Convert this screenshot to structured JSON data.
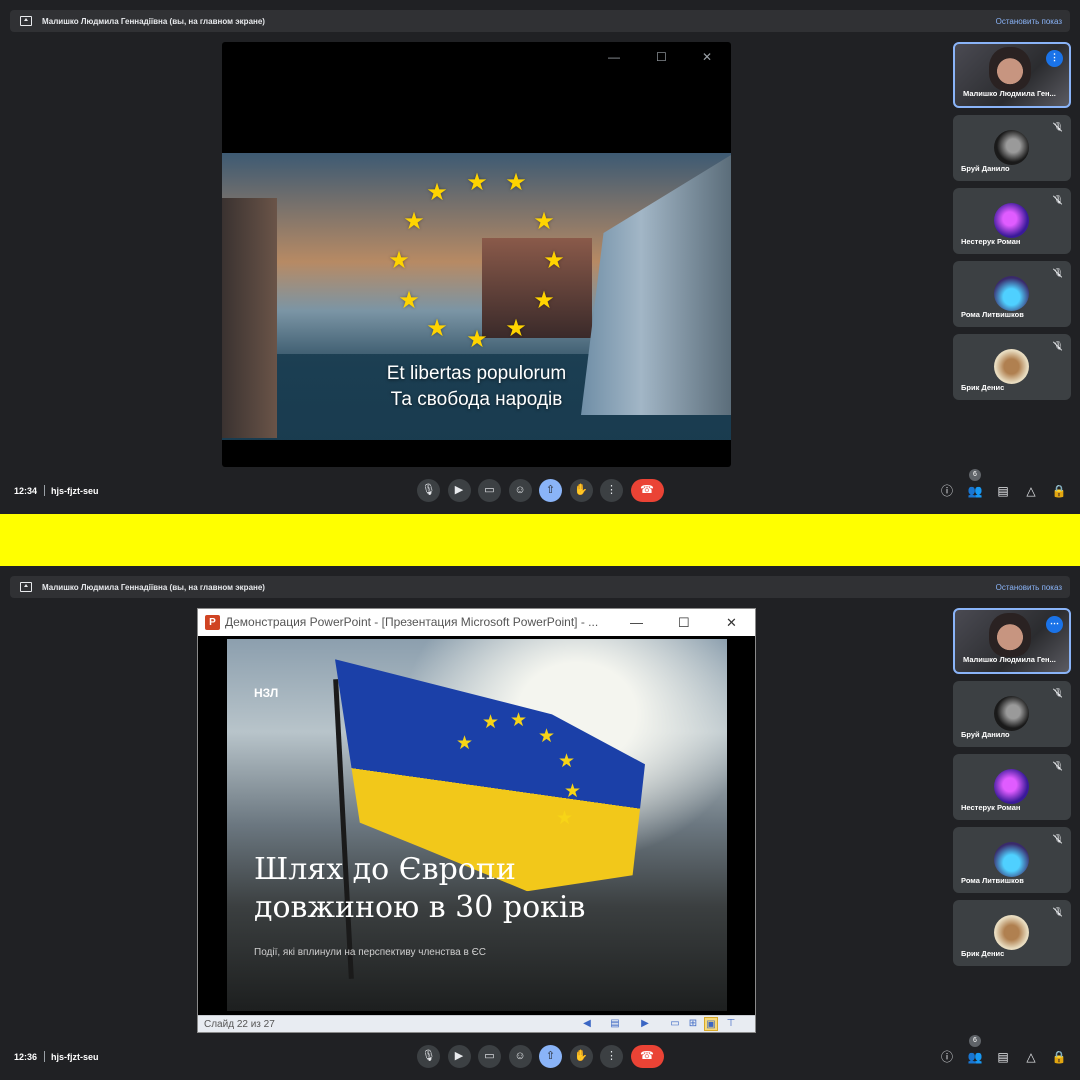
{
  "colors": {
    "background": "#202124",
    "accent": "#8ab4f8",
    "end_call": "#ea4335",
    "divider": "#ffff00"
  },
  "panels": [
    {
      "share_banner": {
        "text": "Малишко Людмила Геннадіївна (вы, на главном экране)",
        "stop_label": "Остановить показ"
      },
      "slide": {
        "caption_line1": "Et libertas populorum",
        "caption_line2": "Та свобода народів"
      },
      "bottom": {
        "time": "12:34",
        "meeting_code": "hjs-fjzt-seu",
        "participants_count": "6"
      }
    },
    {
      "share_banner": {
        "text": "Малишко Людмила Геннадіївна (вы, на главном экране)",
        "stop_label": "Остановить показ"
      },
      "window_title": "Демонстрация PowerPoint - [Презентация Microsoft PowerPoint] - ...",
      "slide": {
        "logo": "НЗЛ",
        "headline_line1": "Шлях до Європи",
        "headline_line2": "довжиною в 30 років",
        "subtitle": "Події, які вплинули на перспективу членства в ЄС"
      },
      "status_bar": {
        "slide_position": "Слайд 22 из 27"
      },
      "bottom": {
        "time": "12:36",
        "meeting_code": "hjs-fjzt-seu",
        "participants_count": "6"
      }
    }
  ],
  "participants": [
    {
      "name": "Малишко Людмила Ген...",
      "self": true
    },
    {
      "name": "Бруй Данило",
      "muted": true
    },
    {
      "name": "Нестерук Роман",
      "muted": true
    },
    {
      "name": "Рома Литвишков",
      "muted": true
    },
    {
      "name": "Брик Денис",
      "muted": true
    }
  ],
  "controls": [
    "mic-icon",
    "camera-icon",
    "captions-icon",
    "emoji-icon",
    "present-icon",
    "raise-hand-icon",
    "more-options-icon",
    "end-call-icon"
  ],
  "right_controls": [
    "info-icon",
    "people-icon",
    "chat-icon",
    "activities-icon",
    "host-controls-icon"
  ]
}
